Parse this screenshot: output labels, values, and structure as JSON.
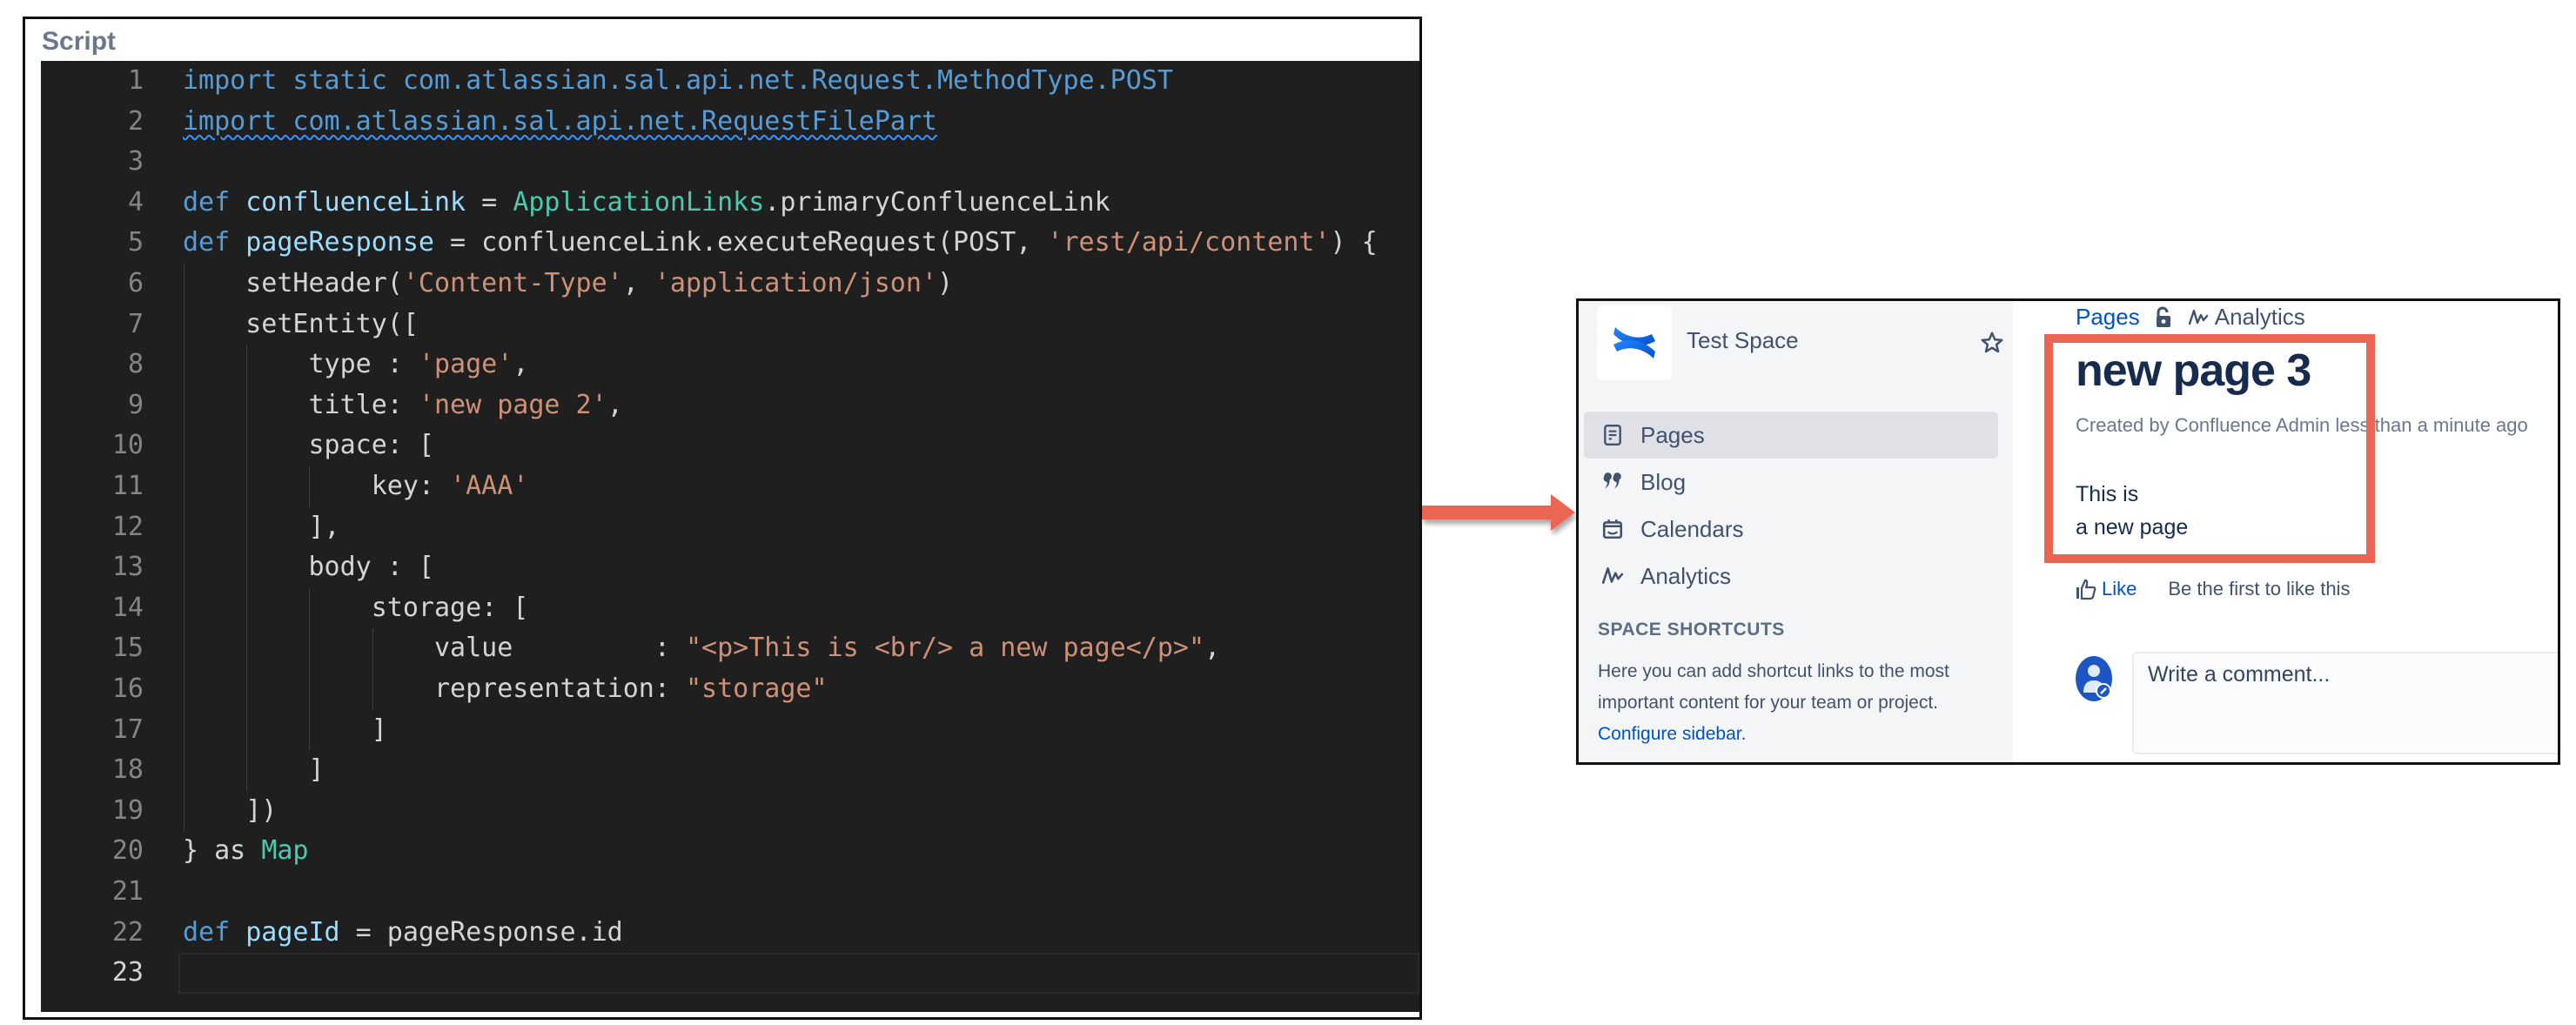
{
  "code_panel": {
    "title": "Script",
    "current_line": 23,
    "lines": [
      {
        "n": "1",
        "tokens": [
          [
            "kw",
            "import static com.atlassian.sal.api.net.Request.MethodType.POST"
          ]
        ]
      },
      {
        "n": "2",
        "tokens": [
          [
            "kw squiggle",
            "import com.atlassian.sal.api.net.RequestFilePart"
          ]
        ]
      },
      {
        "n": "3",
        "tokens": []
      },
      {
        "n": "4",
        "tokens": [
          [
            "kw",
            "def "
          ],
          [
            "var",
            "confluenceLink"
          ],
          [
            "plain",
            " = "
          ],
          [
            "type",
            "ApplicationLinks"
          ],
          [
            "plain",
            ".primaryConfluenceLink"
          ]
        ]
      },
      {
        "n": "5",
        "tokens": [
          [
            "kw",
            "def "
          ],
          [
            "var",
            "pageResponse"
          ],
          [
            "plain",
            " = confluenceLink.executeRequest(POST, "
          ],
          [
            "str",
            "'rest/api/content'"
          ],
          [
            "plain",
            ") {"
          ]
        ]
      },
      {
        "n": "6",
        "tokens": [
          [
            "plain",
            "    setHeader("
          ],
          [
            "str",
            "'Content-Type'"
          ],
          [
            "plain",
            ", "
          ],
          [
            "str",
            "'application/json'"
          ],
          [
            "plain",
            ")"
          ]
        ]
      },
      {
        "n": "7",
        "tokens": [
          [
            "plain",
            "    setEntity(["
          ]
        ]
      },
      {
        "n": "8",
        "tokens": [
          [
            "plain",
            "        type : "
          ],
          [
            "str",
            "'page'"
          ],
          [
            "plain",
            ","
          ]
        ]
      },
      {
        "n": "9",
        "tokens": [
          [
            "plain",
            "        title: "
          ],
          [
            "str",
            "'new page 2'"
          ],
          [
            "plain",
            ","
          ]
        ]
      },
      {
        "n": "10",
        "tokens": [
          [
            "plain",
            "        space: ["
          ]
        ]
      },
      {
        "n": "11",
        "tokens": [
          [
            "plain",
            "            key: "
          ],
          [
            "str",
            "'AAA'"
          ]
        ]
      },
      {
        "n": "12",
        "tokens": [
          [
            "plain",
            "        ],"
          ]
        ]
      },
      {
        "n": "13",
        "tokens": [
          [
            "plain",
            "        body : ["
          ]
        ]
      },
      {
        "n": "14",
        "tokens": [
          [
            "plain",
            "            storage: ["
          ]
        ]
      },
      {
        "n": "15",
        "tokens": [
          [
            "plain",
            "                value         : "
          ],
          [
            "str",
            "\"<p>This is <br/> a new page</p>\""
          ],
          [
            "plain",
            ","
          ]
        ]
      },
      {
        "n": "16",
        "tokens": [
          [
            "plain",
            "                representation: "
          ],
          [
            "str",
            "\"storage\""
          ]
        ]
      },
      {
        "n": "17",
        "tokens": [
          [
            "plain",
            "            ]"
          ]
        ]
      },
      {
        "n": "18",
        "tokens": [
          [
            "plain",
            "        ]"
          ]
        ]
      },
      {
        "n": "19",
        "tokens": [
          [
            "plain",
            "    ])"
          ]
        ]
      },
      {
        "n": "20",
        "tokens": [
          [
            "plain",
            "} as "
          ],
          [
            "type",
            "Map"
          ]
        ]
      },
      {
        "n": "21",
        "tokens": []
      },
      {
        "n": "22",
        "tokens": [
          [
            "kw",
            "def "
          ],
          [
            "var",
            "pageId"
          ],
          [
            "plain",
            " = pageResponse.id"
          ]
        ]
      },
      {
        "n": "23",
        "tokens": []
      }
    ],
    "syntax_colors": {
      "keyword": "#569cd6",
      "variable": "#9cdcfe",
      "type": "#4ec9b0",
      "string": "#ce9178",
      "plain": "#d4d4d4",
      "background": "#1f1f1f"
    }
  },
  "arrow": {
    "color": "#eb6553",
    "direction": "right"
  },
  "confluence": {
    "sidebar": {
      "space_name": "Test Space",
      "logo_icon": "confluence-logo",
      "star_icon": "star-icon",
      "nav": [
        {
          "label": "Pages",
          "icon": "page-icon",
          "active": true
        },
        {
          "label": "Blog",
          "icon": "quote-icon",
          "active": false
        },
        {
          "label": "Calendars",
          "icon": "calendar-icon",
          "active": false
        },
        {
          "label": "Analytics",
          "icon": "analytics-icon",
          "active": false
        }
      ],
      "shortcuts_heading": "SPACE SHORTCUTS",
      "shortcuts_text": "Here you can add shortcut links to the most important content for your team or project.",
      "shortcuts_link": "Configure sidebar."
    },
    "breadcrumbs": {
      "pages": "Pages",
      "analytics": "Analytics"
    },
    "page": {
      "title": "new page 3",
      "byline": "Created by Confluence Admin less than a minute ago",
      "body_line1": "This is",
      "body_line2": "a new page"
    },
    "like": {
      "label": "Like",
      "note": "Be the first to like this"
    },
    "comment": {
      "placeholder": "Write a comment..."
    },
    "highlight_color": "#eb6553",
    "link_color": "#0052cc"
  }
}
